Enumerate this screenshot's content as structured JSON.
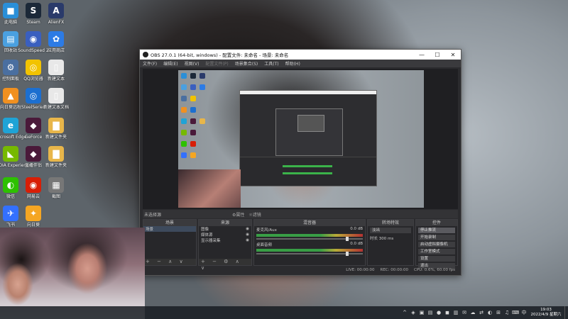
{
  "desktop": {
    "icons": [
      {
        "label": "此电脑",
        "glyph": "■",
        "color": "#2a8fd8"
      },
      {
        "label": "Steam",
        "glyph": "S",
        "color": "#1b2838"
      },
      {
        "label": "AlienFX",
        "glyph": "A",
        "color": "#2a3a6a"
      },
      {
        "label": "回收站",
        "glyph": "▤",
        "color": "#4aa0e0"
      },
      {
        "label": "SoundSpeed 2",
        "glyph": "◉",
        "color": "#3a5fbf"
      },
      {
        "label": "应用商店",
        "glyph": "✿",
        "color": "#2c7be5"
      },
      {
        "label": "控制面板",
        "glyph": "⚙",
        "color": "#4a6fa0"
      },
      {
        "label": "QQ浏览器",
        "glyph": "◎",
        "color": "#f2c300"
      },
      {
        "label": "新建文本",
        "glyph": "▯",
        "color": "#e8e8e8"
      },
      {
        "label": "向日葵远程",
        "glyph": "▲",
        "color": "#f09020"
      },
      {
        "label": "SteelSeries",
        "glyph": "◎",
        "color": "#1c6fd0"
      },
      {
        "label": "新建文本文档",
        "glyph": "▯",
        "color": "#e8e8e8"
      },
      {
        "label": "Microsoft Edge",
        "glyph": "e",
        "color": "#1fa3d6"
      },
      {
        "label": "GeForce",
        "glyph": "◆",
        "color": "#4a1a3a"
      },
      {
        "label": "新建文件夹",
        "glyph": "▇",
        "color": "#e8b64a"
      },
      {
        "label": "NVIDIA Experience",
        "glyph": "◣",
        "color": "#76b900"
      },
      {
        "label": "直播伴侣",
        "glyph": "◆",
        "color": "#4a1a3a"
      },
      {
        "label": "新建文件夹",
        "glyph": "▇",
        "color": "#e8b64a"
      },
      {
        "label": "微信",
        "glyph": "◐",
        "color": "#2dc100"
      },
      {
        "label": "网易云",
        "glyph": "◉",
        "color": "#d81e06"
      },
      {
        "label": "截图",
        "glyph": "▦",
        "color": "#777"
      },
      {
        "label": "飞书",
        "glyph": "✈",
        "color": "#3370ff"
      },
      {
        "label": "向日葵",
        "glyph": "✦",
        "color": "#f5a623"
      }
    ]
  },
  "obs": {
    "title": "OBS 27.0.1 (64-bit, windows) - 配置文件: 未命名 - 场景: 未命名",
    "window_buttons": [
      "—",
      "☐",
      "✕"
    ],
    "menu": [
      "文件(F)",
      "编辑(E)",
      "视图(V)",
      "配置文件(P)",
      "场景集合(S)",
      "工具(T)",
      "帮助(H)"
    ],
    "source_bar": {
      "none_selected": "未选择源",
      "properties": "⚙属性",
      "filters": "☼滤镜"
    },
    "docks": {
      "scenes": {
        "title": "场景",
        "items": [
          "场景"
        ],
        "footer": "+ − ∧ ∨"
      },
      "sources": {
        "title": "来源",
        "items": [
          "图像",
          "媒体源",
          "显示器采集"
        ],
        "footer": "+ − ⚙ ∧ ∨"
      },
      "mixer": {
        "title": "混音器",
        "channels": [
          {
            "name": "麦克风/Aux",
            "db": "0.0 dB"
          },
          {
            "name": "桌面音频",
            "db": "0.0 dB"
          }
        ]
      },
      "transitions": {
        "title": "转场特效",
        "type": "淡出",
        "duration_label": "时长",
        "duration": "300 ms"
      },
      "controls": {
        "title": "控件",
        "buttons": [
          "停止推流",
          "开始录制",
          "启动虚拟摄像机",
          "工作室模式",
          "设置",
          "退出"
        ]
      }
    },
    "status": {
      "live": "LIVE: 00:00:00",
      "rec": "REC: 00:00:00",
      "cpu": "CPU: 0.6%, 60.00 fps"
    }
  },
  "taskbar": {
    "tray": [
      "^",
      "◈",
      "▣",
      "▤",
      "●",
      "◼",
      "▥",
      "✉",
      "☁",
      "⇄",
      "◐",
      "⊞",
      "♫",
      "⌨"
    ],
    "lang": "中",
    "time": "19:03",
    "date": "2022/4/9 星期六"
  }
}
